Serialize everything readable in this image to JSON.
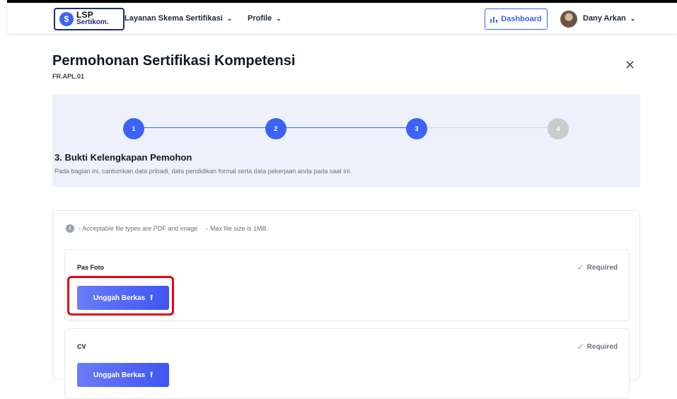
{
  "header": {
    "logo_text_top": "LSP",
    "logo_text_bottom": "Sertikom.",
    "nav_items": [
      {
        "label": "Layanan Skema Sertifikasi"
      },
      {
        "label": "Profile"
      }
    ],
    "dashboard_label": "Dashboard",
    "user_name": "Dany Arkan"
  },
  "page": {
    "title": "Permohonan Sertifikasi Kompetensi",
    "code": "FR.APL.01",
    "close_symbol": "✕"
  },
  "stepper": {
    "steps": [
      "1",
      "2",
      "3",
      "4"
    ],
    "active_step": 3,
    "active_color": "#3b63f5",
    "inactive_color": "#cbcbcb",
    "current_title": "3. Bukti Kelengkapan Pemohon",
    "current_description": "Pada bagian ini, cantumkan data pribadi, data pendidikan formal serta data pekerjaan anda pada saat ini."
  },
  "form": {
    "info_icon": "i",
    "info_file_types": "◦ Acceptable file types are PDF and image",
    "info_max_size": "◦ Max file size is 1MB.",
    "sections": [
      {
        "label": "Pas Foto",
        "required_label": "Required",
        "button_label": "Unggah Berkas"
      },
      {
        "label": "CV",
        "required_label": "Required",
        "button_label": "Unggah Berkas"
      }
    ]
  },
  "colors": {
    "accent": "#3b63f5",
    "highlight": "#e30613"
  },
  "icons": {
    "logo": "logo-icon",
    "dropdown": "chevron-down-icon",
    "dashboard": "bar-chart-icon",
    "close": "close-icon",
    "info": "info-icon",
    "check": "check-icon",
    "upload": "upload-icon"
  }
}
